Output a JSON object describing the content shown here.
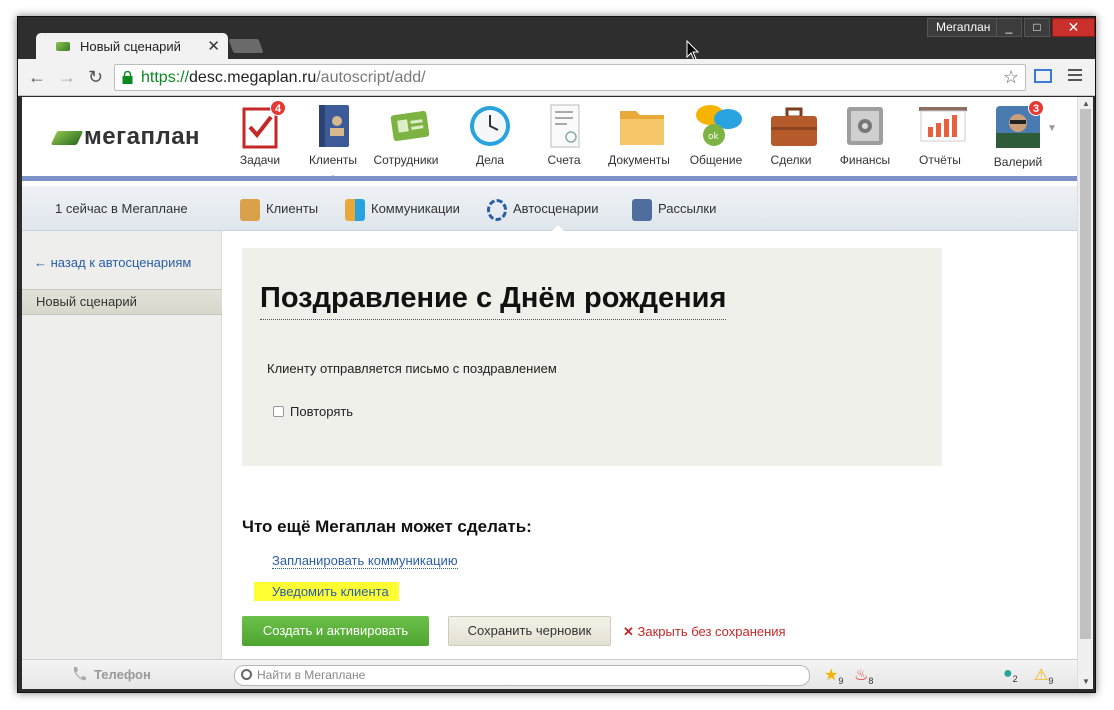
{
  "browser": {
    "tab_title": "Новый сценарий",
    "tab_close": "✕",
    "profile_name": "Мегаплан",
    "url_scheme": "https://",
    "url_host": "desc.megaplan.ru",
    "url_path": "/autoscript/add/"
  },
  "app": {
    "logo_text": "мегаплан",
    "nav": [
      {
        "label": "Задачи",
        "badge": "4"
      },
      {
        "label": "Клиенты"
      },
      {
        "label": "Сотрудники"
      },
      {
        "label": "Дела"
      },
      {
        "label": "Счета"
      },
      {
        "label": "Документы"
      },
      {
        "label": "Общение"
      },
      {
        "label": "Сделки"
      },
      {
        "label": "Финансы"
      },
      {
        "label": "Отчёты"
      }
    ],
    "user": {
      "name": "Валерий",
      "badge": "3"
    },
    "online_text": "1 сейчас в Мегаплане",
    "subnav": [
      {
        "label": "Клиенты"
      },
      {
        "label": "Коммуникации"
      },
      {
        "label": "Автосценарии"
      },
      {
        "label": "Рассылки"
      }
    ]
  },
  "sidebar": {
    "back_link": "← назад к автосценариям",
    "active_item": "Новый сценарий"
  },
  "main": {
    "title": "Поздравление с Днём рождения",
    "description": "Клиенту отправляется письмо с поздравлением",
    "repeat_label": "Повторять",
    "more_heading": "Что ещё Мегаплан может сделать:",
    "links": [
      "Запланировать коммуникацию",
      "Уведомить клиента"
    ],
    "create_button": "Создать и активировать",
    "draft_button": "Сохранить черновик",
    "close_link": "Закрыть без сохранения"
  },
  "bottombar": {
    "phone_label": "Телефон",
    "search_placeholder": "Найти в Мегаплане",
    "stars_count": "9",
    "fire_count": "8",
    "chat_count": "2",
    "warning_count": "9"
  }
}
